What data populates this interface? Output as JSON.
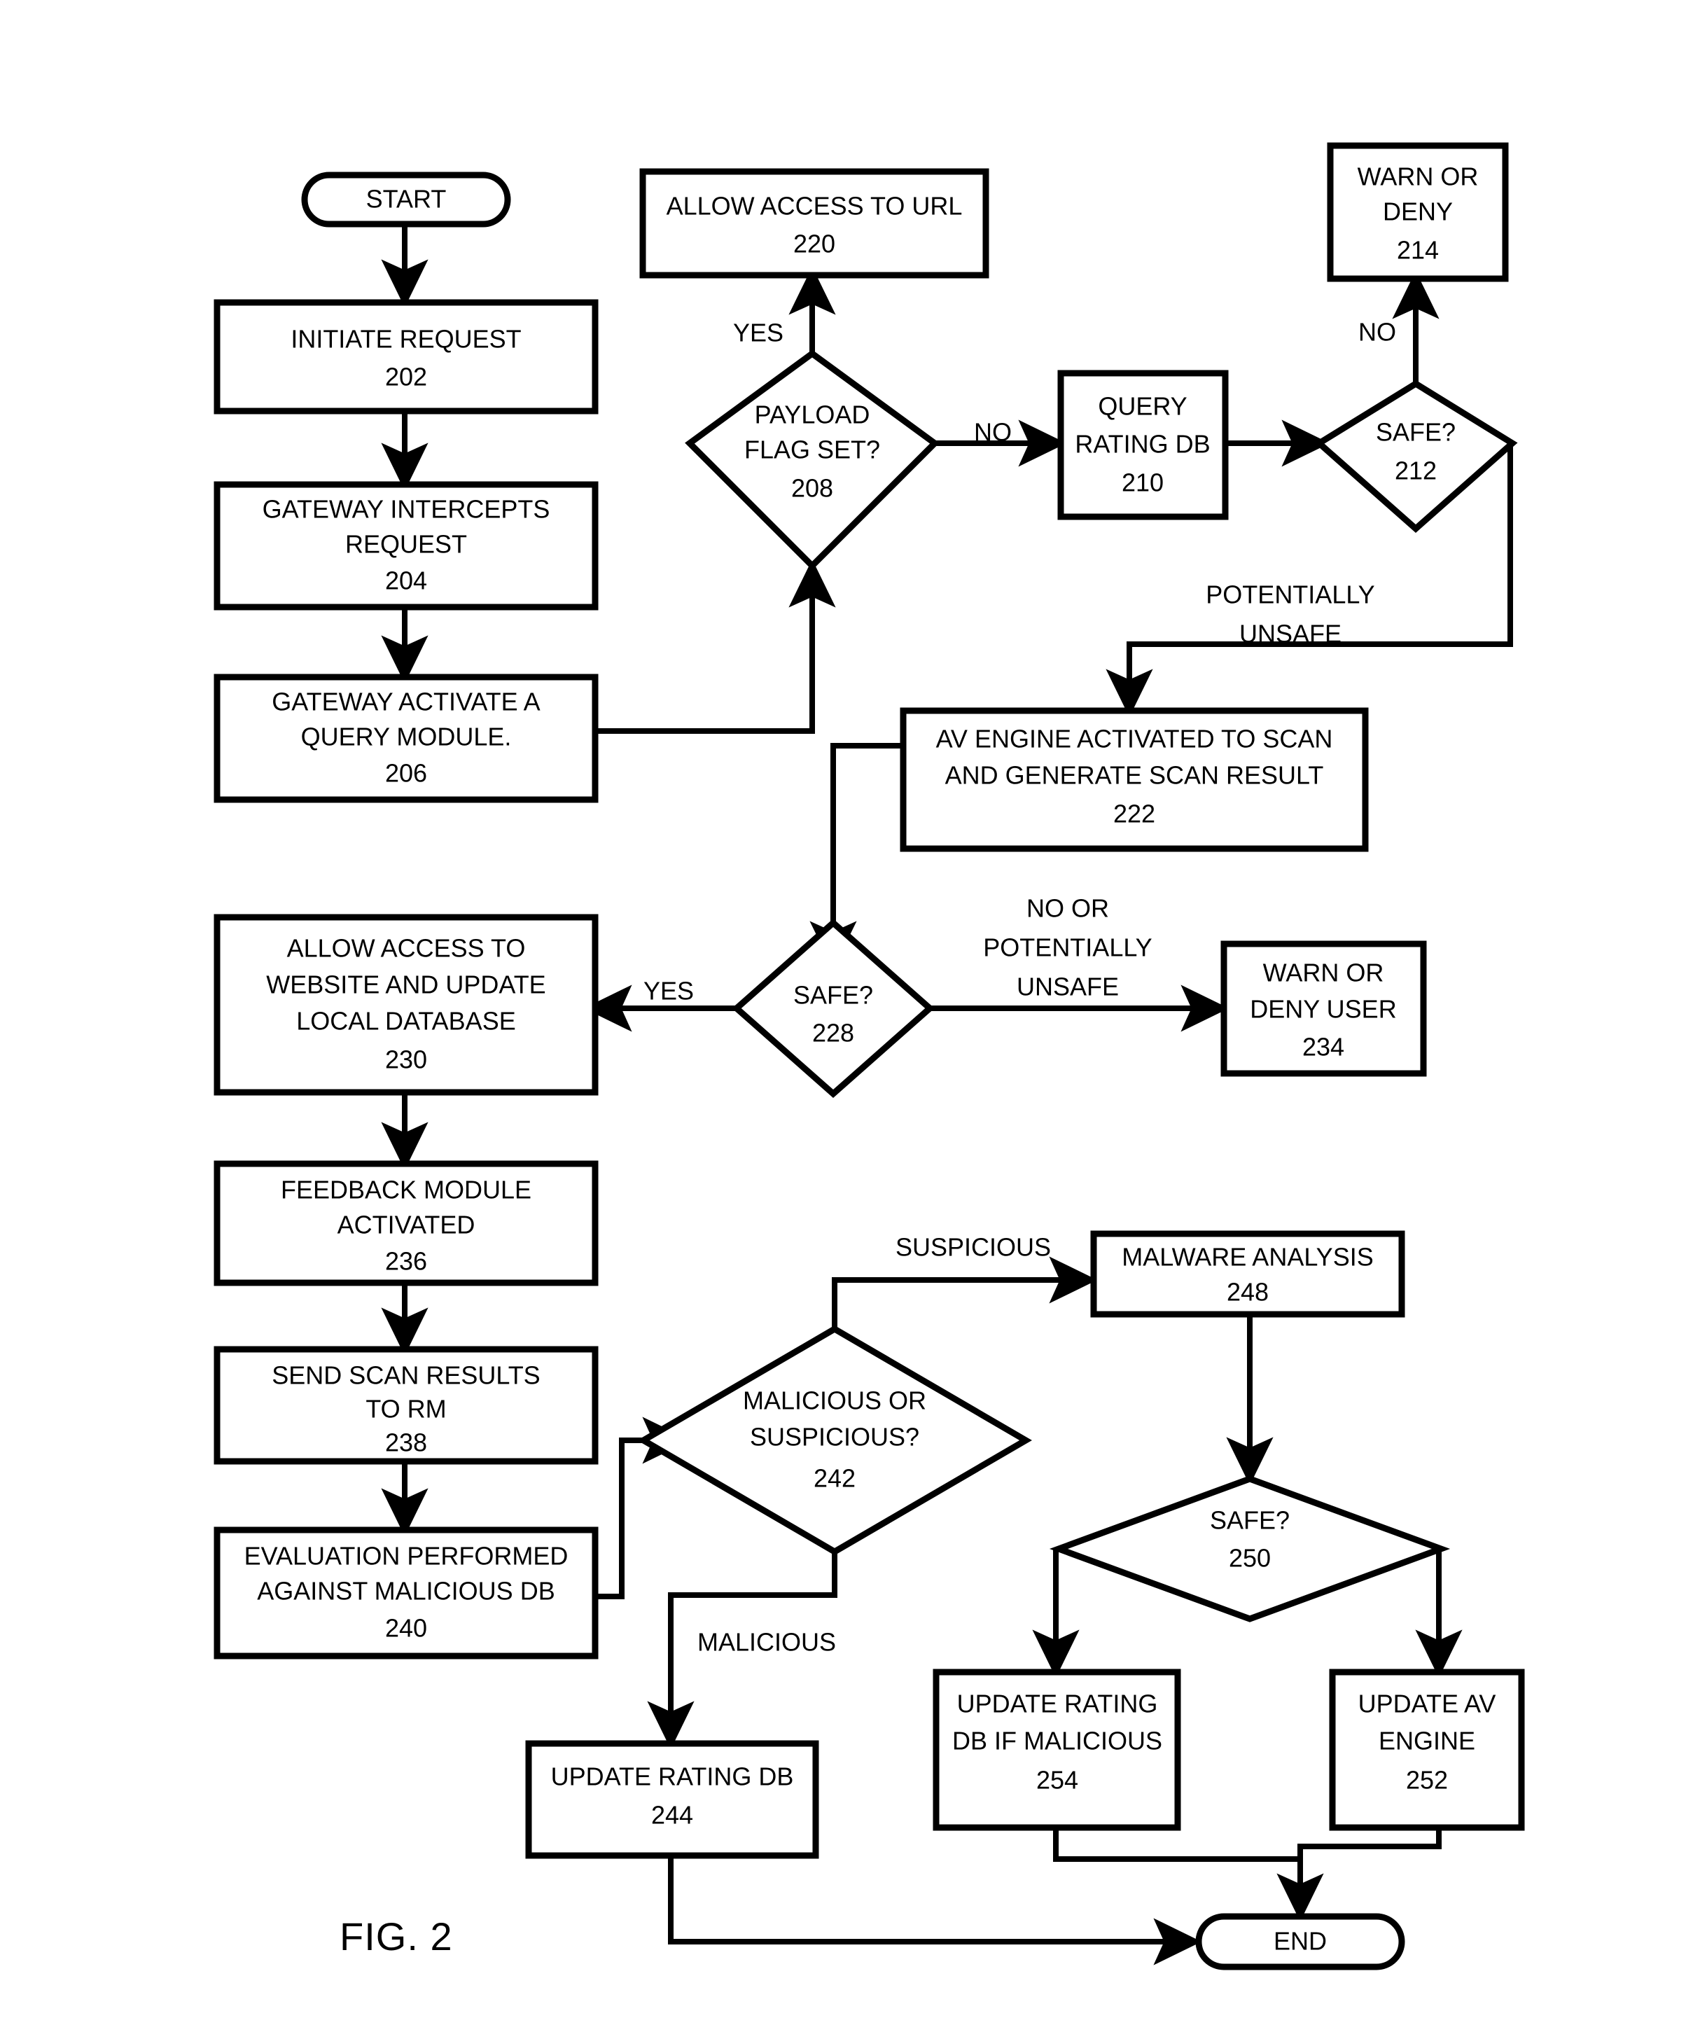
{
  "figure": {
    "label": "FIG. 2",
    "title": "Flowchart 200 — URL request security evaluation process"
  },
  "nodes": {
    "start": {
      "type": "terminator",
      "label": "START"
    },
    "end": {
      "type": "terminator",
      "label": "END"
    },
    "n202": {
      "type": "process",
      "line1": "INITIATE REQUEST",
      "ref": "202"
    },
    "n204": {
      "type": "process",
      "line1": "GATEWAY INTERCEPTS",
      "line2": "REQUEST",
      "ref": "204"
    },
    "n206": {
      "type": "process",
      "line1": "GATEWAY ACTIVATE A",
      "line2": "QUERY MODULE.",
      "ref": "206"
    },
    "n208": {
      "type": "decision",
      "line1": "PAYLOAD",
      "line2": "FLAG SET?",
      "ref": "208"
    },
    "n210": {
      "type": "process",
      "line1": "QUERY",
      "line2": "RATING DB",
      "ref": "210"
    },
    "n212": {
      "type": "decision",
      "line1": "SAFE?",
      "ref": "212"
    },
    "n214": {
      "type": "process",
      "line1": "WARN OR",
      "line2": "DENY",
      "ref": "214"
    },
    "n220": {
      "type": "process",
      "line1": "ALLOW ACCESS TO URL",
      "ref": "220"
    },
    "n222": {
      "type": "process",
      "line1": "AV ENGINE ACTIVATED TO SCAN",
      "line2": "AND GENERATE SCAN RESULT",
      "ref": "222"
    },
    "n228": {
      "type": "decision",
      "line1": "SAFE?",
      "ref": "228"
    },
    "n230": {
      "type": "process",
      "line1": "ALLOW ACCESS TO",
      "line2": "WEBSITE AND UPDATE",
      "line3": "LOCAL DATABASE",
      "ref": "230"
    },
    "n234": {
      "type": "process",
      "line1": "WARN OR",
      "line2": "DENY USER",
      "ref": "234"
    },
    "n236": {
      "type": "process",
      "line1": "FEEDBACK MODULE",
      "line2": "ACTIVATED",
      "ref": "236"
    },
    "n238": {
      "type": "process",
      "line1": "SEND SCAN RESULTS",
      "line2": "TO RM",
      "ref": "238"
    },
    "n240": {
      "type": "process",
      "line1": "EVALUATION PERFORMED",
      "line2": "AGAINST MALICIOUS DB",
      "ref": "240"
    },
    "n242": {
      "type": "decision",
      "line1": "MALICIOUS OR",
      "line2": "SUSPICIOUS?",
      "ref": "242"
    },
    "n244": {
      "type": "process",
      "line1": "UPDATE RATING DB",
      "ref": "244"
    },
    "n248": {
      "type": "process",
      "line1": "MALWARE ANALYSIS",
      "ref": "248"
    },
    "n250": {
      "type": "decision",
      "line1": "SAFE?",
      "ref": "250"
    },
    "n252": {
      "type": "process",
      "line1": "UPDATE AV",
      "line2": "ENGINE",
      "ref": "252"
    },
    "n254": {
      "type": "process",
      "line1": "UPDATE RATING",
      "line2": "DB IF MALICIOUS",
      "ref": "254"
    }
  },
  "edge_labels": {
    "yes_208": "YES",
    "no_208": "NO",
    "no_212": "NO",
    "potentially_unsafe_212_l1": "POTENTIALLY",
    "potentially_unsafe_212_l2": "UNSAFE",
    "yes_228": "YES",
    "no_or_228_l1": "NO OR",
    "no_or_228_l2": "POTENTIALLY",
    "no_or_228_l3": "UNSAFE",
    "suspicious_242": "SUSPICIOUS",
    "malicious_242": "MALICIOUS"
  },
  "style": {
    "ink": "#000000",
    "paper": "#ffffff",
    "thick_stroke": 8,
    "thin_stroke": 6
  }
}
